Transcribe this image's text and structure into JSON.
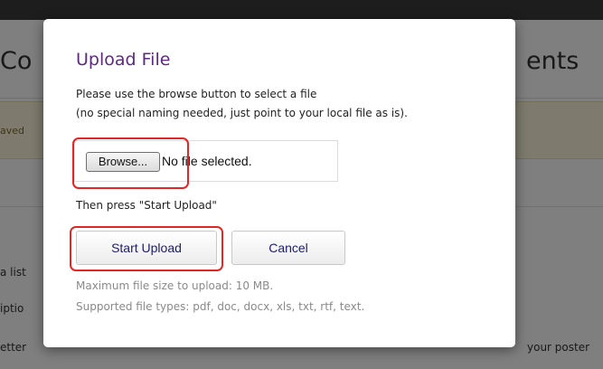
{
  "background": {
    "heading_left": "Co",
    "heading_right": "ents",
    "notice_fragment": "aved",
    "fragment_list": "a list",
    "fragment_desc": "iptio",
    "fragment_letter": "etter",
    "fragment_poster": "your poster"
  },
  "modal": {
    "title": "Upload File",
    "instruction_line1": "Please use the browse button to select a file",
    "instruction_line2": "(no special naming needed, just point to your local file as is).",
    "browse_label": "Browse...",
    "file_status": "No file selected.",
    "then_text": "Then press \"Start Upload\"",
    "start_upload_label": "Start Upload",
    "cancel_label": "Cancel",
    "max_size_note": "Maximum file size to upload: 10 MB.",
    "supported_types_note": "Supported file types: pdf, doc, docx, xls, txt, rtf, text."
  },
  "colors": {
    "title": "#5c2a7e",
    "highlight": "#e02626",
    "button_text": "#1d1d6e",
    "note_text": "#8a8a8a"
  }
}
